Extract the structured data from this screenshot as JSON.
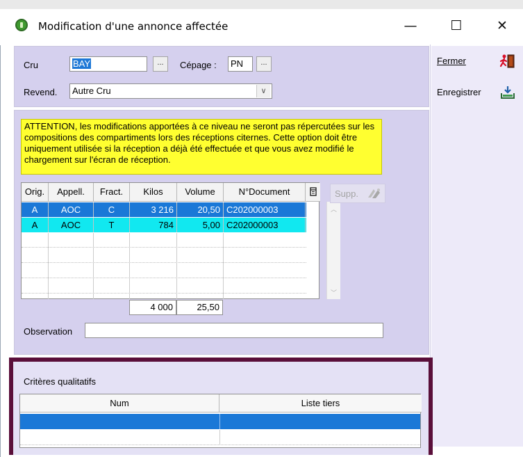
{
  "window": {
    "title": "Modification d'une annonce affectée",
    "minimize_glyph": "—",
    "maximize_glyph": "☐",
    "close_glyph": "✕"
  },
  "form": {
    "cru_label": "Cru",
    "cru_value": "BAY",
    "cru_browse": "...",
    "cepage_label": "Cépage :",
    "cepage_value": "PN",
    "cepage_browse": "...",
    "revend_label": "Revend.",
    "revend_value": "Autre Cru",
    "revend_arrow": "∨"
  },
  "side_buttons": {
    "close_label": "Fermer",
    "save_label": "Enregistrer"
  },
  "warning": "ATTENTION, les modifications apportées à ce niveau ne seront pas répercutées sur les compositions des compartiments lors des réceptions citernes. Cette option doit être uniquement utilisée si la réception a déjà été effectuée et que vous avez modifié le chargement sur l'écran de réception.",
  "table": {
    "headers": [
      "Orig.",
      "Appell.",
      "Fract.",
      "Kilos",
      "Volume",
      "N°Document"
    ],
    "rows": [
      [
        "A",
        "AOC",
        "C",
        "3 216",
        "20,50",
        "C202000003"
      ],
      [
        "A",
        "AOC",
        "T",
        "784",
        "5,00",
        "C202000003"
      ]
    ],
    "totals": {
      "kilos": "4 000",
      "volume": "25,50"
    },
    "supp_label": "Supp."
  },
  "observation": {
    "label": "Observation",
    "value": ""
  },
  "criteria": {
    "title": "Critères qualitatifs",
    "headers": [
      "Num",
      "Liste tiers"
    ]
  },
  "colors": {
    "panel": "#d5d0ee",
    "warning_bg": "#ffff30",
    "selected_row": "#1a78d7",
    "second_row": "#11e8f0",
    "highlight_frame": "#5a0f3a"
  }
}
